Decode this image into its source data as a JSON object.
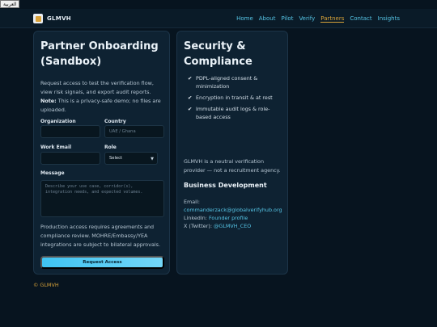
{
  "lang_toggle": "العربية",
  "brand": {
    "name": "GLMVH"
  },
  "nav": [
    {
      "label": "Home"
    },
    {
      "label": "About"
    },
    {
      "label": "Pilot"
    },
    {
      "label": "Verify"
    },
    {
      "label": "Partners",
      "active": true
    },
    {
      "label": "Contact"
    },
    {
      "label": "Insights"
    }
  ],
  "form": {
    "title": "Partner Onboarding (Sandbox)",
    "intro_text": "Request access to test the verification flow, view risk signals, and export audit reports.",
    "intro_note_label": "Note:",
    "intro_note_text": "This is a privacy-safe demo; no files are uploaded.",
    "organization_label": "Organization",
    "organization_value": "",
    "country_label": "Country",
    "country_placeholder": "UAE / Ghana",
    "email_label": "Work Email",
    "email_value": "",
    "role_label": "Role",
    "role_selected": "Select",
    "message_label": "Message",
    "message_placeholder": "Describe your use case, corridor(s), integration needs, and expected volumes.",
    "production_note": "Production access requires agreements and compliance review. MOHRE/Embassy/YEA integrations are subject to bilateral approvals.",
    "submit_label": "Request Access"
  },
  "security": {
    "title": "Security & Compliance",
    "items": [
      "PDPL-aligned consent & minimization",
      "Encryption in transit & at rest",
      "Immutable audit logs & role-based access"
    ],
    "neutral_text": "GLMVH is a neutral verification provider — not a recruitment agency.",
    "bd_title": "Business Development",
    "email_label": "Email:",
    "email_value": "commanderzack@globalverifyhub.org",
    "linkedin_label": "LinkedIn:",
    "linkedin_link": "Founder profile",
    "twitter_label": "X (Twitter):",
    "twitter_handle": "@GLMVH_CEO"
  },
  "footer": {
    "text": "© GLMVH"
  },
  "colors": {
    "accent": "#56c5e6",
    "active": "#d8a339",
    "background": "#07141f",
    "card": "#0e2232"
  }
}
